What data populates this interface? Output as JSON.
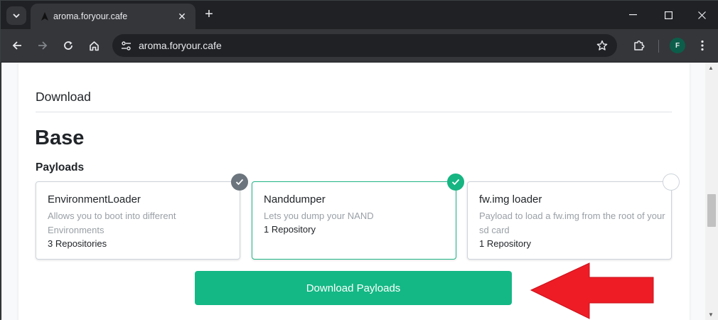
{
  "browser": {
    "tab_title": "aroma.foryour.cafe",
    "url": "aroma.foryour.cafe",
    "avatar_letter": "F"
  },
  "page": {
    "section_title": "Download",
    "base_title": "Base",
    "payloads_label": "Payloads",
    "payloads": [
      {
        "name": "EnvironmentLoader",
        "description": "Allows you to boot into different Environments",
        "repositories": "3 Repositories",
        "check_state": "checked-grey"
      },
      {
        "name": "Nanddumper",
        "description": "Lets you dump your NAND",
        "repositories": "1 Repository",
        "check_state": "checked-green"
      },
      {
        "name": "fw.img loader",
        "description": "Payload to load a fw.img from the root of your sd card",
        "repositories": "1 Repository",
        "check_state": "unchecked"
      }
    ],
    "download_button_label": "Download Payloads"
  },
  "colors": {
    "accent_green": "#14b884",
    "annotation_arrow": "#ee1c25"
  },
  "icons": {
    "tab_search": "chevron-down-icon",
    "back": "arrow-left-icon",
    "forward": "arrow-right-icon",
    "reload": "reload-icon",
    "home": "home-icon",
    "site_info": "tune-icon",
    "bookmark": "star-icon",
    "extensions": "puzzle-icon",
    "menu": "kebab-menu-icon"
  }
}
